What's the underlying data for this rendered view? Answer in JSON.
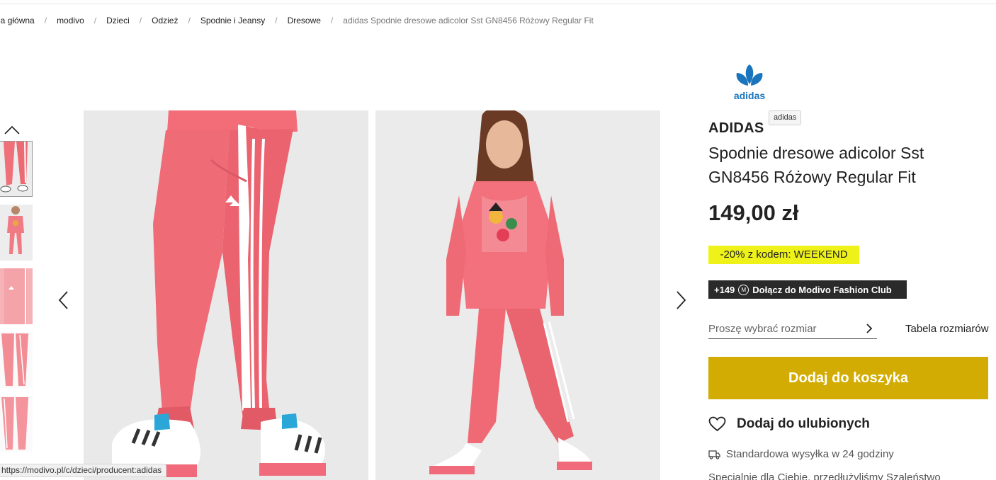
{
  "breadcrumb": [
    {
      "label": "Strona główna"
    },
    {
      "label": "modivo"
    },
    {
      "label": "Dzieci"
    },
    {
      "label": "Odzież"
    },
    {
      "label": "Spodnie i Jeansy"
    },
    {
      "label": "Dresowe"
    },
    {
      "label": "adidas Spodnie dresowe adicolor Sst GN8456 Różowy Regular Fit"
    }
  ],
  "brand": {
    "logo_text": "adidas",
    "tooltip": "adidas",
    "name": "ADIDAS"
  },
  "product": {
    "title": "Spodnie dresowe adicolor Sst GN8456 Różowy Regular Fit",
    "price": "149,00 zł",
    "promo": "-20% z kodem: WEEKEND",
    "club": {
      "points": "+149",
      "icon_letter": "M",
      "label": "Dołącz do Modivo Fashion Club"
    },
    "size_placeholder": "Proszę wybrać rozmiar",
    "size_chart_label": "Tabela rozmiarów",
    "add_to_cart_label": "Dodaj do koszyka",
    "wishlist_label": "Dodaj do ulubionych",
    "shipping_label": "Standardowa wysyłka w 24 godziny",
    "extra_text": "Specjalnie dla Ciebie, przedłużyliśmy Szaleństwo"
  },
  "status_bar": {
    "url": "https://modivo.pl/c/dzieci/producent:adidas"
  },
  "colors": {
    "promo_bg": "#eef219",
    "cart_button": "#d3ac03",
    "club_bg": "#2a2a2a",
    "product_pink": "#f0707a"
  },
  "icons": {
    "gallery_up": "chevron-up-icon",
    "gallery_prev": "chevron-left-icon",
    "gallery_next": "chevron-right-icon",
    "size_select": "chevron-right-icon",
    "wishlist": "heart-icon",
    "shipping": "truck-icon"
  }
}
